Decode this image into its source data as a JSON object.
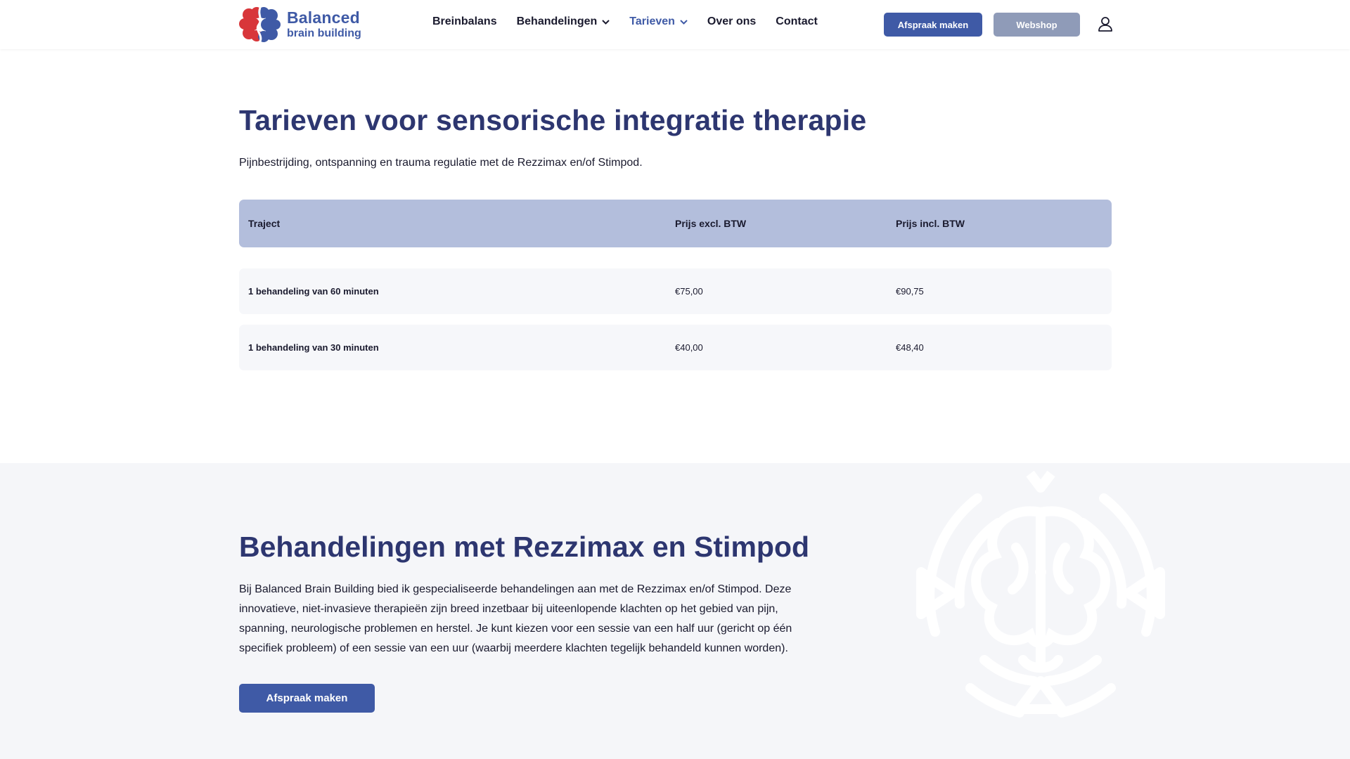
{
  "header": {
    "logo": {
      "line1": "Balanced",
      "line2": "brain building"
    },
    "nav": [
      {
        "label": "Breinbalans",
        "has_dropdown": false,
        "active": false
      },
      {
        "label": "Behandelingen",
        "has_dropdown": true,
        "active": false
      },
      {
        "label": "Tarieven",
        "has_dropdown": true,
        "active": true
      },
      {
        "label": "Over ons",
        "has_dropdown": false,
        "active": false
      },
      {
        "label": "Contact",
        "has_dropdown": false,
        "active": false
      }
    ],
    "cta_label": "Afspraak maken",
    "webshop_label": "Webshop",
    "user_icon": "user-icon"
  },
  "pricing": {
    "title": "Tarieven voor sensorische integratie therapie",
    "subtitle": "Pijnbestrijding, ontspanning en trauma regulatie met de Rezzimax en/of Stimpod.",
    "columns": [
      "Traject",
      "Prijs excl. BTW",
      "Prijs incl. BTW"
    ],
    "rows": [
      [
        "1 behandeling van 60 minuten",
        "€75,00",
        "€90,75"
      ],
      [
        "1 behandeling van 30 minuten",
        "€40,00",
        "€48,40"
      ]
    ]
  },
  "treatments": {
    "title": "Behandelingen met Rezzimax en Stimpod",
    "paragraph": "Bij Balanced Brain Building bied ik gespecialiseerde behandelingen aan met de Rezzimax en/of Stimpod. Deze innovatieve, niet-invasieve therapieën zijn breed inzetbaar bij uiteenlopende klachten op het gebied van pijn, spanning, neurologische problemen en herstel. Je kunt kiezen voor een sessie van een half uur (gericht op één specifiek probleem) of een sessie van een uur (waarbij meerdere klachten tegelijk behandeld kunnen worden).",
    "button_label": "Afspraak maken"
  },
  "colors": {
    "brand_blue": "#3f5aa6",
    "heading_navy": "#2d3670",
    "logo_red": "#d8363a",
    "table_header": "#b3bedc",
    "webshop_gray": "#8f9bb8"
  }
}
